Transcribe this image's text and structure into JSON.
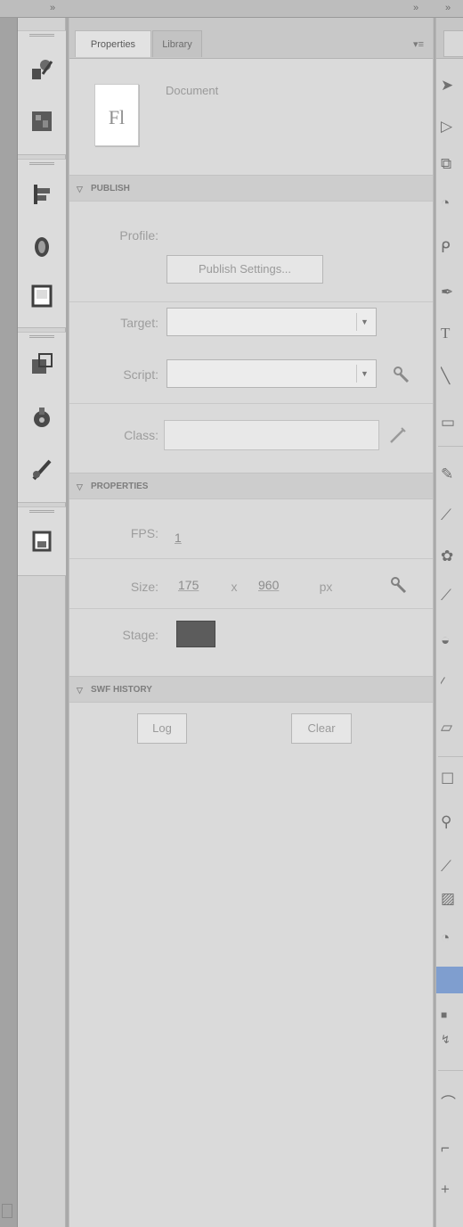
{
  "top_strip": {
    "collapse_glyph": "»"
  },
  "dock": {
    "icons": [
      "motion-presets-icon",
      "library-stack-icon",
      "align-icon",
      "color-icon",
      "swatches-icon",
      "transform-icon",
      "components-icon",
      "code-snippets-icon",
      "history-icon"
    ]
  },
  "panel": {
    "tabs": [
      {
        "label": "Properties",
        "active": true
      },
      {
        "label": "Library",
        "active": false
      }
    ],
    "menu_glyph": "▾≡",
    "document": {
      "icon_text": "Fl",
      "label": "Document"
    },
    "publish": {
      "header": "PUBLISH",
      "profile_label": "Profile:",
      "publish_settings_button": "Publish Settings...",
      "target_label": "Target:",
      "target_value": "",
      "script_label": "Script:",
      "script_value": "",
      "class_label": "Class:",
      "class_value": ""
    },
    "properties": {
      "header": "PROPERTIES",
      "fps_label": "FPS:",
      "fps_value": "1",
      "size_label": "Size:",
      "width_value": "175",
      "size_x": "x",
      "height_value": "960",
      "size_unit": "px",
      "stage_label": "Stage:",
      "stage_color": "#5c5c5c"
    },
    "swf_history": {
      "header": "SWF HISTORY",
      "log_button": "Log",
      "clear_button": "Clear"
    }
  },
  "tools": {
    "selected_fill_color": "#7f9ecf",
    "items": [
      "selection-tool-icon",
      "subselection-tool-icon",
      "free-transform-tool-icon",
      "3d-rotation-tool-icon",
      "lasso-tool-icon",
      "pen-tool-icon",
      "text-tool-icon",
      "line-tool-icon",
      "rectangle-tool-icon",
      "pencil-tool-icon",
      "brush-tool-icon",
      "deco-tool-icon",
      "bone-tool-icon",
      "paint-bucket-tool-icon",
      "eyedropper-tool-icon",
      "eraser-tool-icon",
      "hand-tool-icon",
      "zoom-tool-icon",
      "stroke-color-icon",
      "fill-color-icon"
    ]
  }
}
